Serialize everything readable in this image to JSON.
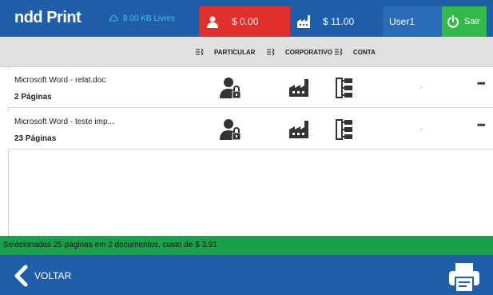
{
  "header": {
    "logo": "ndd Print",
    "storage_text": "8.00 KB Livres",
    "personal_balance": "$ 0.00",
    "corporate_balance": "$ 11.00",
    "user": "User1",
    "exit_label": "Sair"
  },
  "filters": [
    {
      "label": "PARTICULAR",
      "icon": "filter-icon"
    },
    {
      "label": "CORPORATIVO",
      "icon": "filter-icon"
    },
    {
      "label": "CONTA",
      "icon": "filter-icon"
    }
  ],
  "documents": [
    {
      "name": "Microsoft Word - relat.doc",
      "pages": "2 Páginas",
      "cost": "-",
      "more": "•••"
    },
    {
      "name": "Microsoft Word - teste imp...",
      "pages": "23 Páginas",
      "cost": "-",
      "more": "•••"
    }
  ],
  "status": "Selecionadas 25 páginas em 2 documentos, custo de $ 3.91",
  "footer": {
    "back_label": "VOLTAR"
  },
  "colors": {
    "primary": "#1f5faa",
    "red": "#e12f2b",
    "green": "#33b84a",
    "status_green": "#1aa04a"
  }
}
